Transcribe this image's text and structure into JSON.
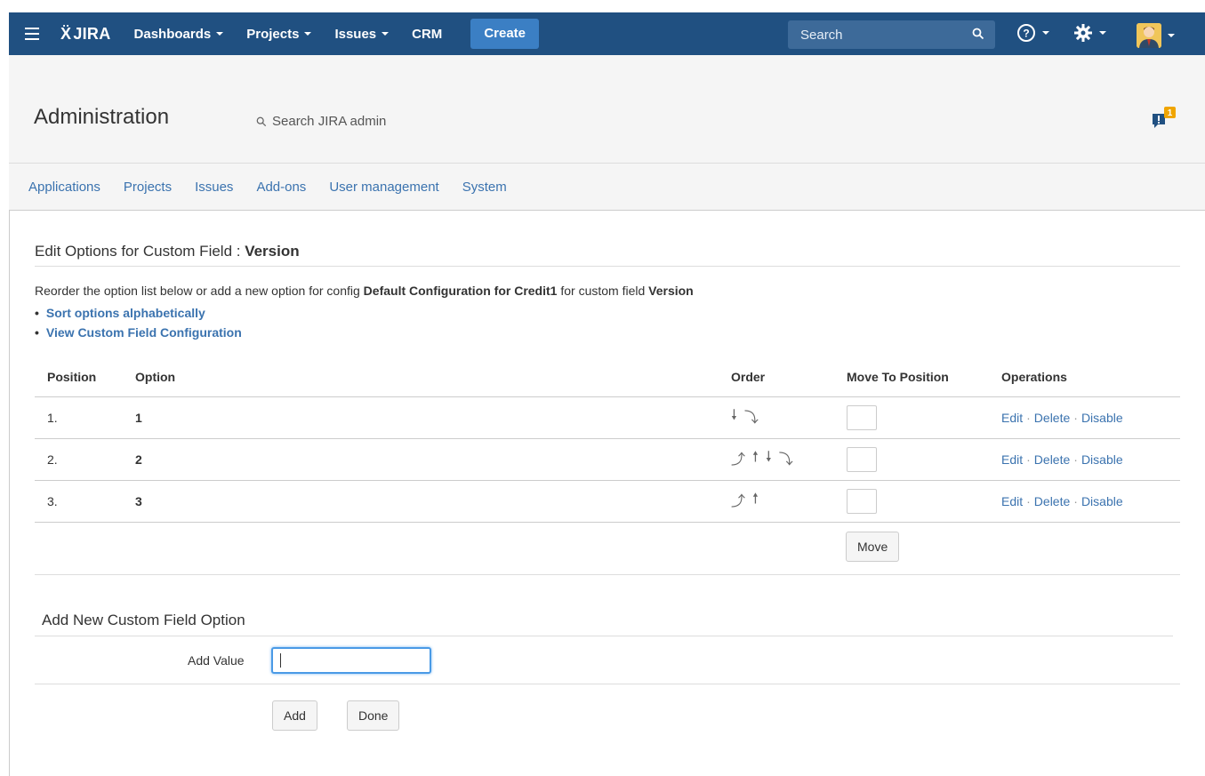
{
  "header": {
    "logo_text": "JIRA",
    "nav": [
      {
        "label": "Dashboards",
        "dropdown": true
      },
      {
        "label": "Projects",
        "dropdown": true
      },
      {
        "label": "Issues",
        "dropdown": true
      },
      {
        "label": "CRM",
        "dropdown": false
      }
    ],
    "create_label": "Create",
    "search_placeholder": "Search",
    "brand_color": "#205081"
  },
  "admin": {
    "title": "Administration",
    "search_label": "Search JIRA admin",
    "notification_count": "1",
    "tabs": [
      "Applications",
      "Projects",
      "Issues",
      "Add-ons",
      "User management",
      "System"
    ]
  },
  "edit_section": {
    "title_prefix": "Edit Options for Custom Field : ",
    "field_name": "Version",
    "desc_prefix": "Reorder the option list below or add a new option for config ",
    "config_name": "Default Configuration for Credit1",
    "desc_middle": " for custom field ",
    "desc_field": "Version",
    "links": [
      "Sort options alphabetically",
      "View Custom Field Configuration"
    ]
  },
  "table": {
    "headers": [
      "Position",
      "Option",
      "Order",
      "Move To Position",
      "Operations"
    ],
    "rows": [
      {
        "position": "1.",
        "option": "1",
        "arrows": [
          "down",
          "to-bottom"
        ]
      },
      {
        "position": "2.",
        "option": "2",
        "arrows": [
          "to-top",
          "up",
          "down",
          "to-bottom"
        ]
      },
      {
        "position": "3.",
        "option": "3",
        "arrows": [
          "to-top",
          "up"
        ]
      }
    ],
    "operations": [
      "Edit",
      "Delete",
      "Disable"
    ],
    "move_button": "Move"
  },
  "add_section": {
    "title": "Add New Custom Field Option",
    "label": "Add Value",
    "value": "",
    "add_button": "Add",
    "done_button": "Done"
  }
}
